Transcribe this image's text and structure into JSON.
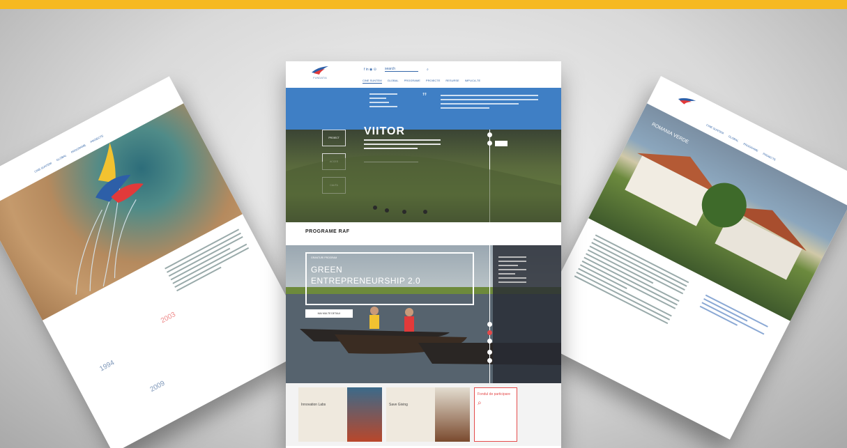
{
  "colors": {
    "accent": "#f6b921",
    "brand": "#3f7fc5",
    "alert": "#e44a4a"
  },
  "center": {
    "logo_text": "FUNDATIA",
    "top_icons": "f in ◉ ⊙",
    "search_placeholder": "search",
    "menu": [
      "CINE SUNTEM",
      "GLOBAL",
      "PROGRAME",
      "PROIECTE",
      "RESURSE",
      "IMPLICA-TE"
    ],
    "quote_mark": "”",
    "hero": {
      "title": "VIITOR",
      "cta": "—",
      "tags": [
        "PROIECT",
        "ACCES",
        "CAUTA"
      ]
    },
    "programe_title": "PROGRAME RAF",
    "feature": {
      "kicker": "GRANTURI PROGRAM",
      "line1": "GREEN",
      "line2": "ENTREPRENEURSHIP 2.0",
      "button": "MAI MULTE DETALII"
    },
    "cards": [
      {
        "kicker": "",
        "title": "Innovation Labs"
      },
      {
        "kicker": "",
        "title": "Save Giving"
      }
    ],
    "right_card": "Fondul de participare"
  },
  "left": {
    "years": [
      "1994",
      "2003",
      "2009"
    ],
    "menu": [
      "CINE SUNTEM",
      "GLOBAL",
      "PROGRAME",
      "PROIECTE",
      "RESURSE",
      "IMPLICA-TE"
    ]
  },
  "right": {
    "menu": [
      "CINE SUNTEM",
      "GLOBAL",
      "PROGRAME",
      "PROIECTE",
      "RESURSE",
      "IMPLICA-TE"
    ],
    "hero_caption": "ROMANIA VERDE"
  }
}
